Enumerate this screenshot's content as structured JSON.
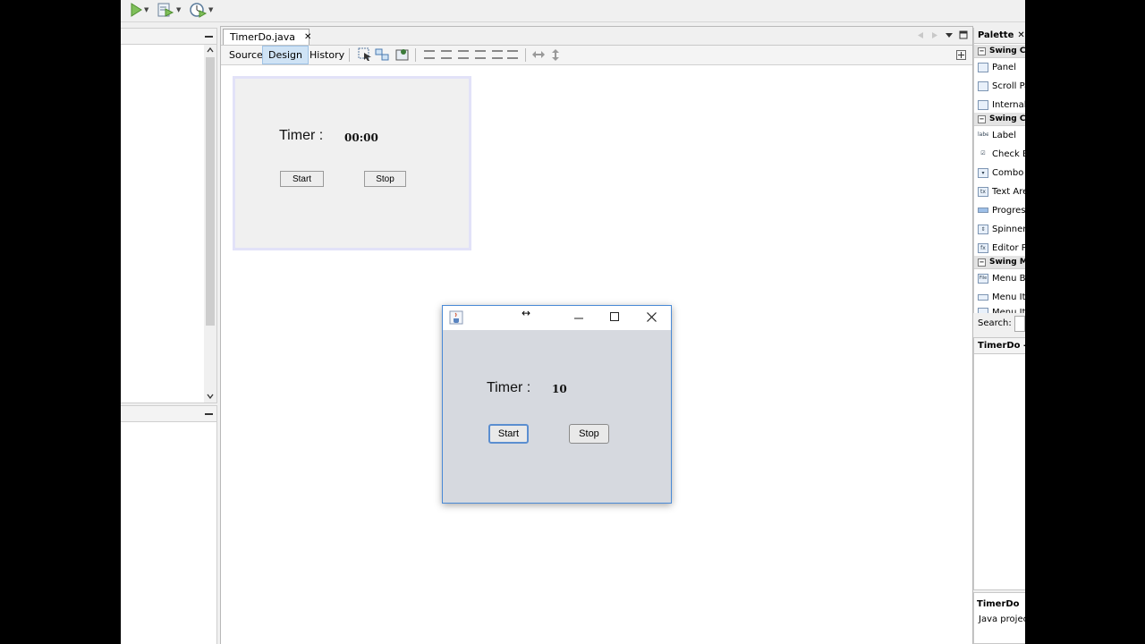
{
  "editor": {
    "file_tab": "TimerDo.java",
    "close_glyph": "✕",
    "sub_tabs": [
      "Source",
      "Design",
      "History"
    ]
  },
  "design_form": {
    "timer_label": "Timer :",
    "timer_value": "00:00",
    "start_button": "Start",
    "stop_button": "Stop"
  },
  "running_window": {
    "timer_label": "Timer :",
    "timer_value": "10",
    "start_button": "Start",
    "stop_button": "Stop",
    "resize_cursor": "↔"
  },
  "palette": {
    "title": "Palette",
    "categories": [
      {
        "label": "Swing C",
        "items": [
          "Panel",
          "Scroll Pa",
          "Internal"
        ]
      },
      {
        "label": "Swing C",
        "items": [
          "Label",
          "Check Bo",
          "Combo B",
          "Text Are",
          "Progress",
          "Spinner",
          "Editor Pa"
        ]
      },
      {
        "label": "Swing M",
        "items": [
          "Menu Ba",
          "Menu Ite",
          "Menu It"
        ]
      }
    ],
    "search_label": "Search:"
  },
  "navigator": {
    "title": "TimerDo - "
  },
  "properties": {
    "title": "TimerDo",
    "subtitle": "Java project"
  },
  "colors": {
    "accent": "#4a8ad6",
    "design_tab_bg": "#cfe3f5",
    "run_window_bg": "#d6d9df"
  }
}
